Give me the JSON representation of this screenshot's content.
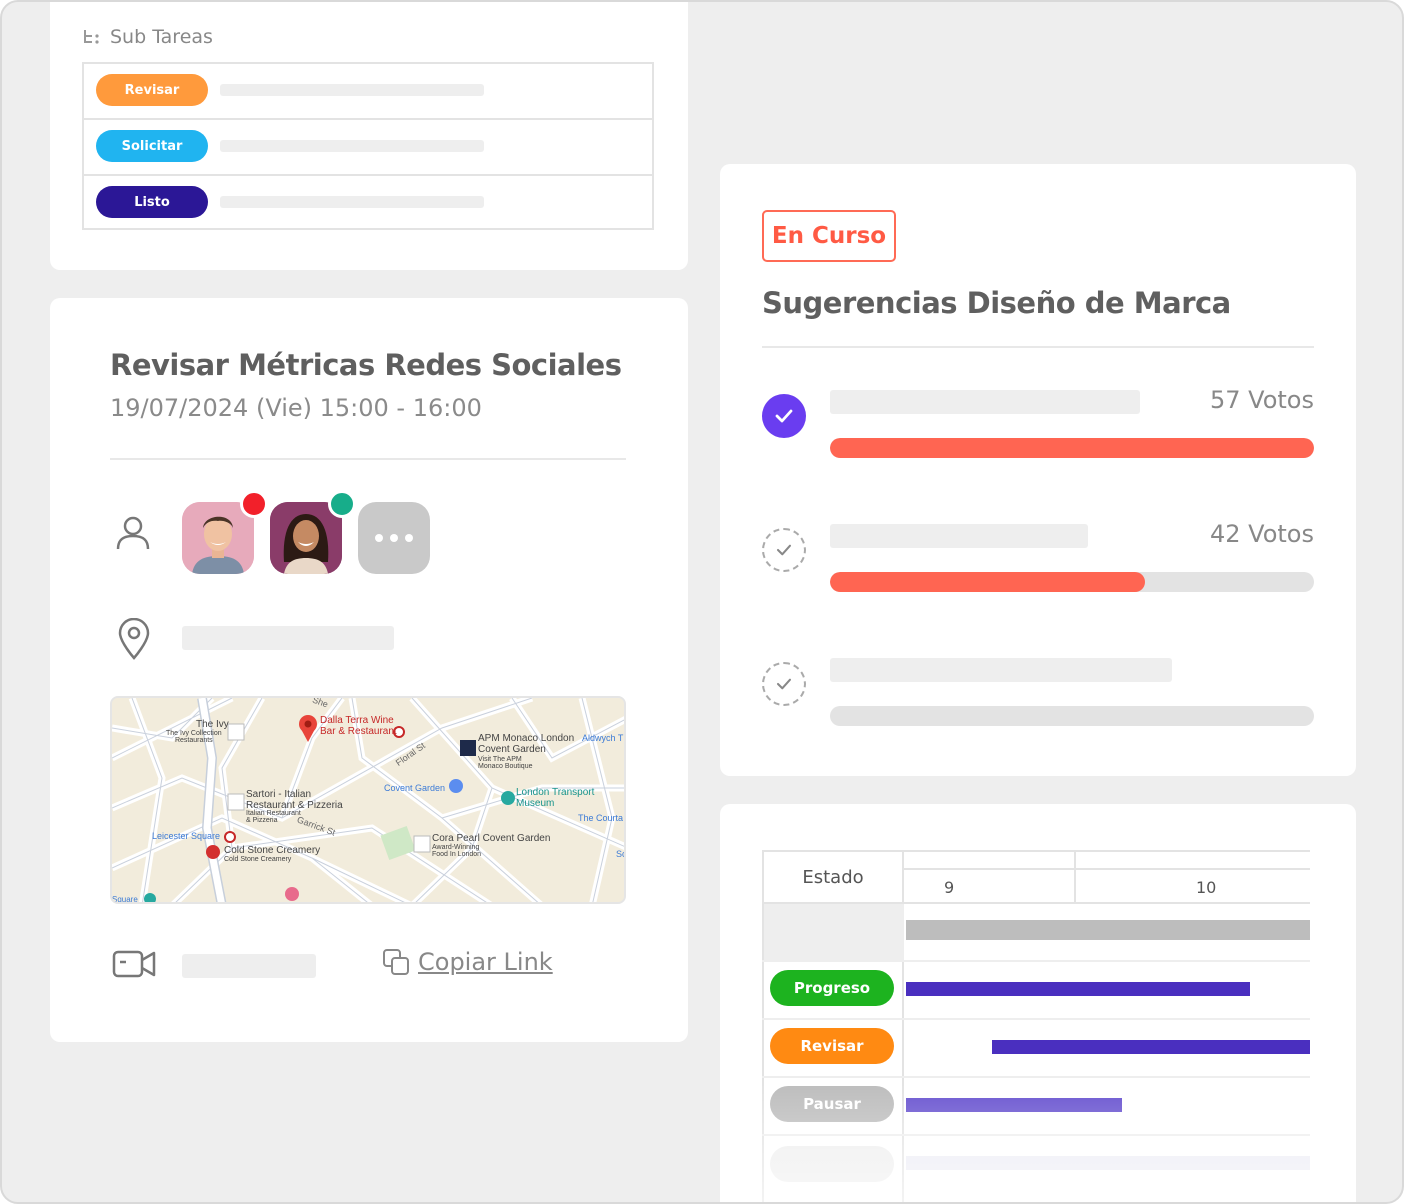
{
  "subtasks": {
    "heading": "Sub Tareas",
    "rows": [
      {
        "label": "Revisar",
        "color": "#ff9a3c"
      },
      {
        "label": "Solicitar",
        "color": "#20b4f0"
      },
      {
        "label": "Listo",
        "color": "#2b1796"
      }
    ]
  },
  "event": {
    "title": "Revisar Métricas Redes Sociales",
    "date": "19/07/2024 (Vie) 15:00 - 16:00",
    "attendee_status_colors": [
      "#f2202a",
      "#17ad8a"
    ],
    "copy_link": "Copiar Link",
    "map_labels": {
      "ivy": "The Ivy",
      "ivy_sub": "The Ivy Collection\nRestaurants",
      "dalla": "Dalla Terra Wine\nBar & Restaurant",
      "apm": "APM Monaco London\nCovent Garden",
      "apm_sub": "Visit The APM\nMonaco Boutique",
      "aldwych": "Aldwych T",
      "floral": "Floral St",
      "covent": "Covent Garden",
      "ltm": "London Transport\nMuseum",
      "courtauld": "The Courta",
      "sartori": "Sartori - Italian\nRestaurant & Pizzeria",
      "sartori_sub": "Italian Restaurant\n& Pizzeria",
      "garrick": "Garrick St",
      "leicester": "Leicester Square",
      "coldstone": "Cold Stone Creamery",
      "coldstone_sub": "Cold Stone Creamery",
      "cora": "Cora Pearl Covent Garden",
      "cora_sub": "Award-Winning\nFood In London",
      "shelton": "She",
      "square": "Square",
      "sc": "Sc"
    }
  },
  "poll": {
    "status": "En Curso",
    "title": "Sugerencias Diseño de Marca",
    "options": [
      {
        "votes_label": "57 Votos",
        "fill": 1.0,
        "selected": true
      },
      {
        "votes_label": "42 Votos",
        "fill": 0.65,
        "selected": false
      },
      {
        "votes_label": "",
        "fill": 0.0,
        "selected": false
      }
    ],
    "accent": "#6a3df0",
    "bar_color": "#ff6552"
  },
  "gantt": {
    "column_header": "Estado",
    "time_labels": [
      "9",
      "10"
    ],
    "rows": [
      {
        "label": "Progreso",
        "color": "#1db31f"
      },
      {
        "label": "Revisar",
        "color": "#ff8a12"
      },
      {
        "label": "Pausar",
        "color": "#bdbdbd"
      }
    ],
    "bar_color": "#4a2fbf"
  }
}
